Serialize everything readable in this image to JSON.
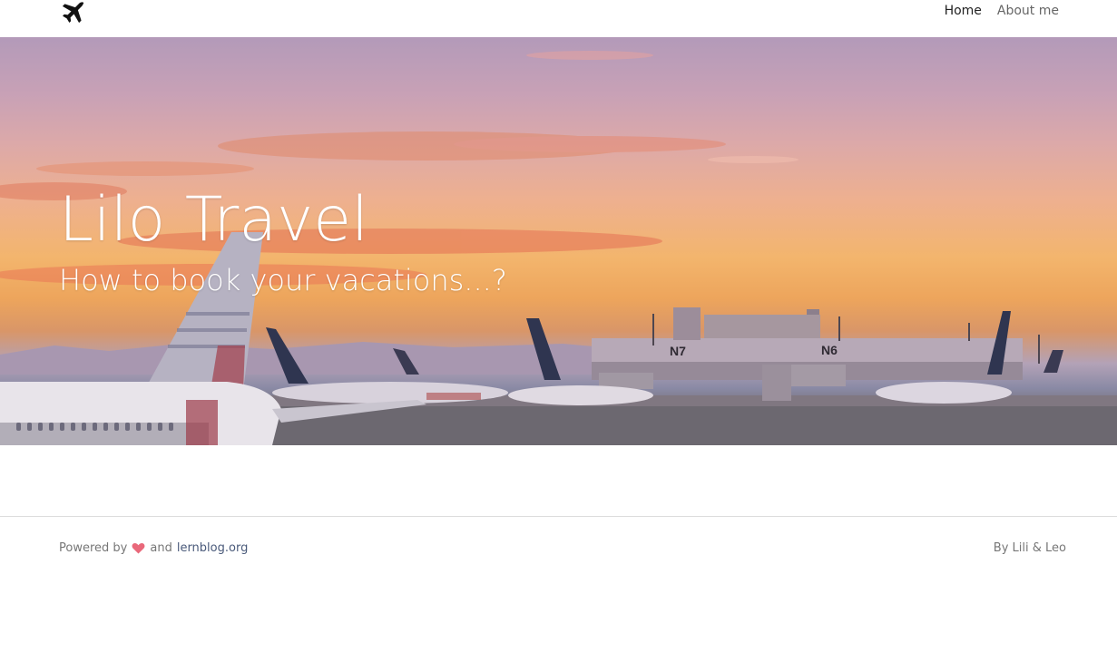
{
  "nav": {
    "logo_icon": "airplane-icon",
    "items": [
      {
        "label": "Home",
        "active": true
      },
      {
        "label": "About me",
        "active": false
      }
    ]
  },
  "hero": {
    "title": "Lilo Travel",
    "subtitle": "How to book your vacations...?",
    "background": "airport-sunset-photo",
    "gate_signs": [
      "N7",
      "N6"
    ]
  },
  "footer": {
    "powered_by": "Powered by",
    "heart_icon": "heart-icon",
    "and": "and",
    "link": "lernblog.org",
    "credits": "By Lili & Leo"
  },
  "colors": {
    "nav_active": "#222222",
    "nav_inactive": "#666666",
    "heart": "#e9687a",
    "footer_link": "#4a5a7a"
  }
}
